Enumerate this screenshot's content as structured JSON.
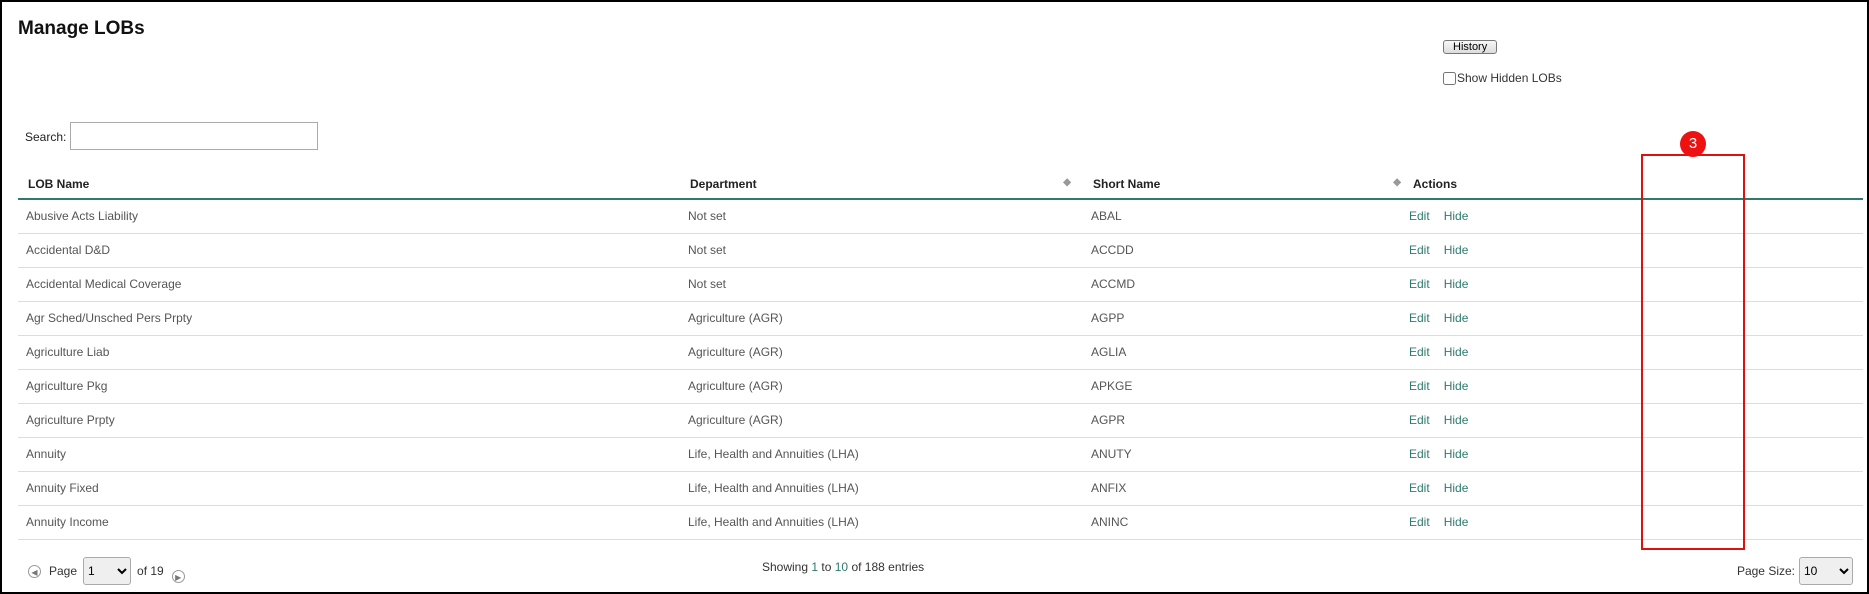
{
  "page": {
    "title": "Manage LOBs"
  },
  "toolbar": {
    "history_label": "History",
    "show_hidden_label": "Show Hidden LOBs"
  },
  "search": {
    "label": "Search:",
    "value": ""
  },
  "table": {
    "columns": [
      "LOB Name",
      "Department",
      "Short Name",
      "Actions"
    ],
    "rows": [
      {
        "name": "Abusive Acts Liability",
        "department": "Not set",
        "short": "ABAL"
      },
      {
        "name": "Accidental D&D",
        "department": "Not set",
        "short": "ACCDD"
      },
      {
        "name": "Accidental Medical Coverage",
        "department": "Not set",
        "short": "ACCMD"
      },
      {
        "name": "Agr Sched/Unsched Pers Prpty",
        "department": "Agriculture (AGR)",
        "short": "AGPP"
      },
      {
        "name": "Agriculture Liab",
        "department": "Agriculture (AGR)",
        "short": "AGLIA"
      },
      {
        "name": "Agriculture Pkg",
        "department": "Agriculture (AGR)",
        "short": "APKGE"
      },
      {
        "name": "Agriculture Prpty",
        "department": "Agriculture (AGR)",
        "short": "AGPR"
      },
      {
        "name": "Annuity",
        "department": "Life, Health and Annuities (LHA)",
        "short": "ANUTY"
      },
      {
        "name": "Annuity Fixed",
        "department": "Life, Health and Annuities (LHA)",
        "short": "ANFIX"
      },
      {
        "name": "Annuity Income",
        "department": "Life, Health and Annuities (LHA)",
        "short": "ANINC"
      }
    ],
    "edit_label": "Edit",
    "hide_label": "Hide"
  },
  "annotation": {
    "badge": "3"
  },
  "pagination": {
    "page_label": "Page",
    "current_page": "1",
    "of_label": "of 19",
    "showing_prefix": "Showing ",
    "showing_from": "1",
    "showing_middle": " to ",
    "showing_to": "10",
    "showing_suffix": " of 188 entries",
    "page_size_label": "Page Size:",
    "page_size": "10"
  },
  "colors": {
    "link": "#2e7a6e",
    "highlight": "#e01010",
    "header_rule": "#2e7a6e"
  },
  "icons": {
    "prev": "circle-left-arrow",
    "next": "circle-right-arrow",
    "sort": "sort-diamond"
  }
}
